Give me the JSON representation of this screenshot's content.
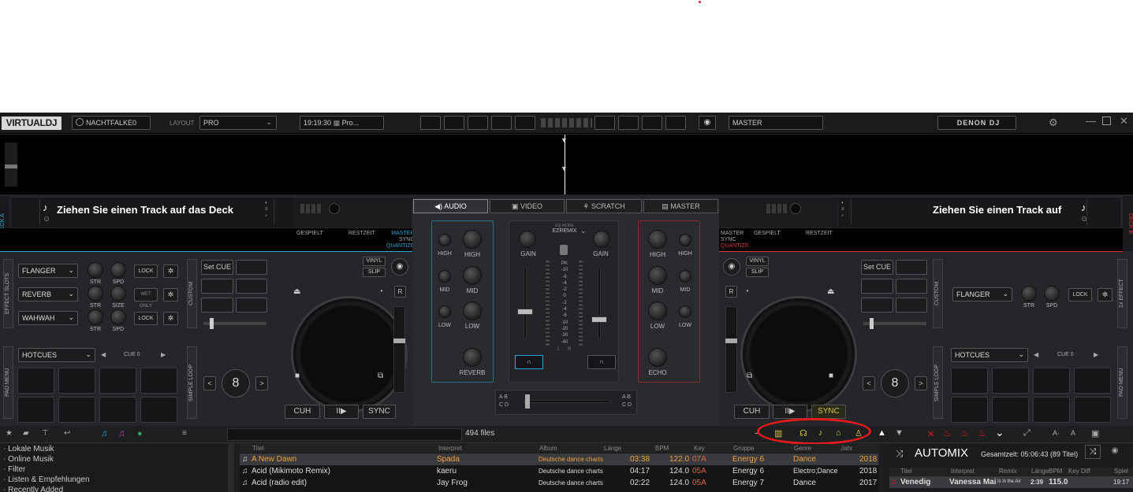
{
  "top": {
    "logo": "VIRTUALDJ",
    "user": "NACHTFALKE0",
    "layout_label": "LAYOUT",
    "layout_value": "PRO",
    "time": "19:19:30",
    "pro": "Pro...",
    "master": "MASTER",
    "brand": "DENON DJ"
  },
  "deckA": {
    "side": "DECK A",
    "prompt": "Ziehen Sie einen Track auf das Deck",
    "played": "GESPIELT",
    "remain": "RESTZEIT",
    "master": "MASTER",
    "sync": "SYNC",
    "quantize": "QUANTIZE",
    "effect_slots": "EFFECT SLOTS",
    "fx": [
      "FLANGER",
      "REVERB",
      "WAHWAH"
    ],
    "fx_labels": [
      [
        "STR",
        "SPD"
      ],
      [
        "STR",
        "SIZE"
      ],
      [
        "STR",
        "SPD"
      ]
    ],
    "lock": "LOCK",
    "wet": "WET ONLY",
    "custom": "CUSTOM",
    "setcue": "Set CUE",
    "vinyl": "VINYL",
    "slip": "SLIP",
    "pad_menu": "PAD MENU",
    "hotcues": "HOTCUES",
    "cue": "CUE 0",
    "simple_loop": "SIMPLE LOOP",
    "loop": "8",
    "cuh": "CUH",
    "play": "II▶",
    "syncbtn": "SYNC"
  },
  "deckB": {
    "side": "DECK B",
    "prompt": "Ziehen Sie einen Track auf",
    "master": "MASTER",
    "sync": "SYNC",
    "quantize": "QUANTIZE",
    "played": "GESPIELT",
    "remain": "RESTZEIT",
    "effect_side": "1x EFFECT",
    "fx": "FLANGER",
    "fx_labels": [
      "STR",
      "SPD"
    ],
    "lock": "LOCK",
    "custom": "CUSTOM",
    "setcue": "Set CUE",
    "vinyl": "VINYL",
    "slip": "SLIP",
    "pad_menu": "PAD MENU",
    "hotcues": "HOTCUES",
    "cue": "CUE 0",
    "simple_loop": "SIMPLE LOOP",
    "loop": "8",
    "cuh": "CUH",
    "play": "II▶",
    "syncbtn": "SYNC"
  },
  "mixer": {
    "tabs": [
      "AUDIO",
      "VIDEO",
      "SCRATCH",
      "MASTER"
    ],
    "eq_label": "EQ MODE",
    "eq_value": "EZREMIX",
    "gain": "GAIN",
    "high": "HIGH",
    "mid": "MID",
    "low": "LOW",
    "reverb": "REVERB",
    "echo": "ECHO",
    "meter": [
      "PK",
      "-10",
      "-6",
      "-4",
      "-2",
      "0",
      "-2",
      "-4",
      "-6",
      "-10",
      "-20",
      "-30",
      "-40"
    ],
    "l": "L",
    "r": "R"
  },
  "browser": {
    "files": "494 files",
    "tree": [
      "Lokale Musik",
      "Online Musik",
      "Filter",
      "Listen & Empfehlungen",
      "Recently Added"
    ],
    "columns": [
      "Titel",
      "Interpret",
      "Album",
      "Länge",
      "BPM",
      "Key",
      "Gruppe",
      "Genre",
      "Jahr"
    ],
    "rows": [
      [
        "A New Dawn",
        "Spada",
        "Deutsche dance charts",
        "03:38",
        "122.0",
        "07A",
        "Energy 6",
        "Dance",
        "2018"
      ],
      [
        "Acid (Mikimoto Remix)",
        "kaeru",
        "Deutsche dance charts",
        "04:17",
        "124.0",
        "05A",
        "Energy 6",
        "Electro;Dance",
        "2018"
      ],
      [
        "Acid (radio edit)",
        "Jay Frog",
        "Deutsche dance charts",
        "02:22",
        "124.0",
        "05A",
        "Energy 7",
        "Dance",
        "2017"
      ]
    ]
  },
  "automix": {
    "title": "AUTOMIX",
    "total": "Gesamtzeit: 05:06:43 (89 Titel)",
    "columns": [
      "Titel",
      "Interpret",
      "Remix",
      "Länge",
      "BPM",
      "Key Diff",
      "Spiel"
    ],
    "row": [
      "Venedig",
      "Vanessa Mai",
      "Is in the Air",
      "2:39",
      "115.0",
      "",
      "19:17"
    ]
  },
  "colors": {
    "accent_a": "#2aa9d8",
    "accent_b": "#d83a3a",
    "annotation": "#e11b1b",
    "sync_b": "#d7c63a"
  }
}
